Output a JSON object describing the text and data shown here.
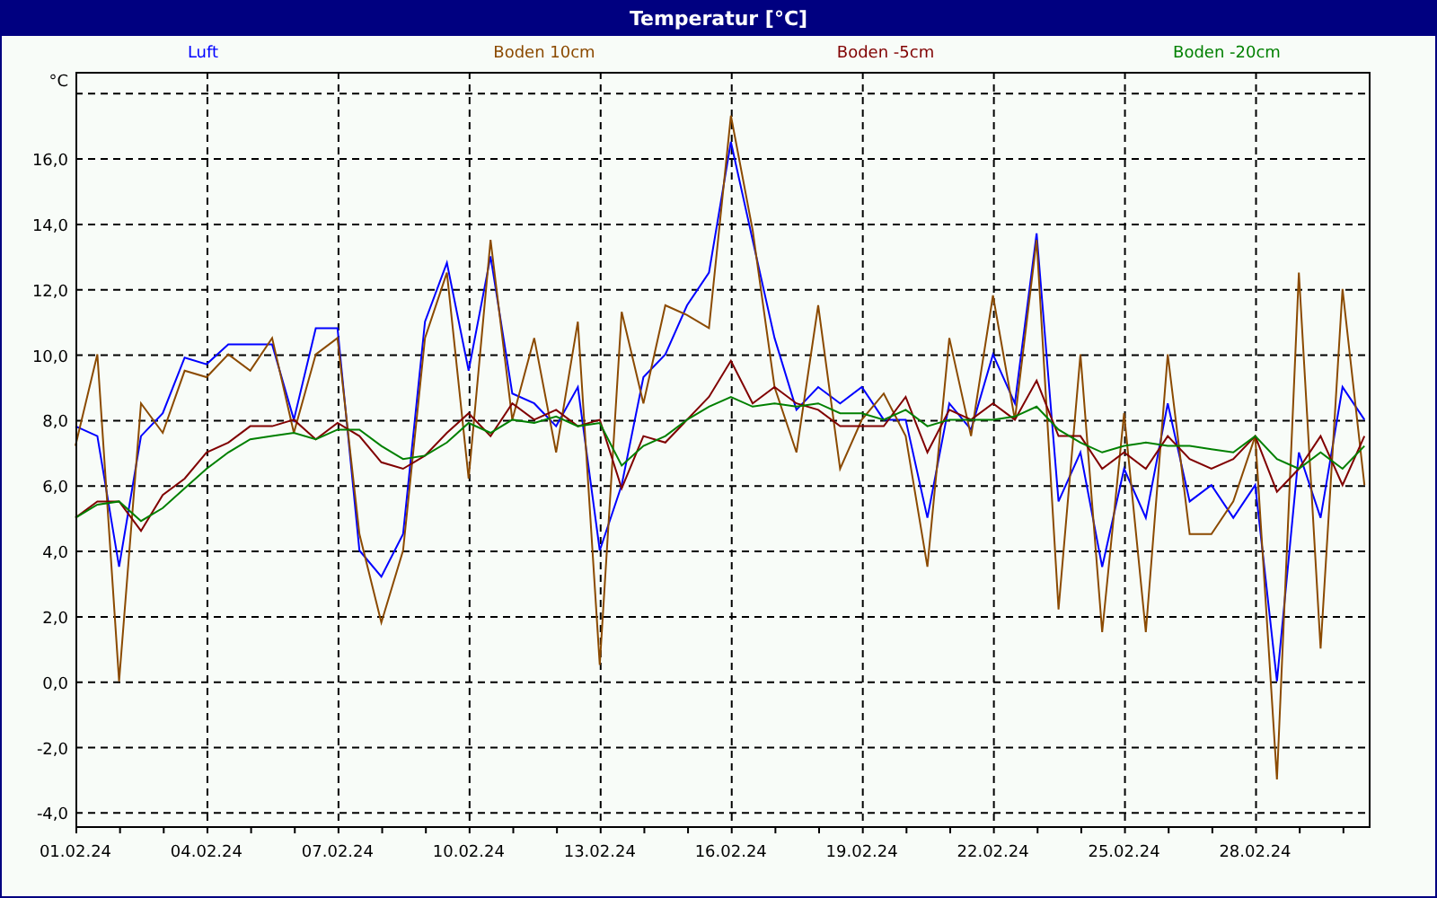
{
  "window": {
    "title": "Temperatur [°C]"
  },
  "chart": {
    "chart_data": {
      "type": "line",
      "ylabel": "°C",
      "categories": [
        "01.02.24",
        null,
        null,
        null,
        null,
        null,
        "04.02.24",
        null,
        null,
        null,
        null,
        null,
        "07.02.24",
        null,
        null,
        null,
        null,
        null,
        "10.02.24",
        null,
        null,
        null,
        null,
        null,
        "13.02.24",
        null,
        null,
        null,
        null,
        null,
        "16.02.24",
        null,
        null,
        null,
        null,
        null,
        "19.02.24",
        null,
        null,
        null,
        null,
        null,
        "22.02.24",
        null,
        null,
        null,
        null,
        null,
        "25.02.24",
        null,
        null,
        null,
        null,
        null,
        "28.02.24",
        null,
        null,
        null,
        null,
        null
      ],
      "series": [
        {
          "name": "Luft",
          "color": "#0000ff",
          "values": [
            7.8,
            7.5,
            3.5,
            7.5,
            8.2,
            9.9,
            9.7,
            10.3,
            10.3,
            10.3,
            8.0,
            10.8,
            10.8,
            4.0,
            3.2,
            4.5,
            11.0,
            12.8,
            9.5,
            13.0,
            8.8,
            8.5,
            7.8,
            9.0,
            4.0,
            6.0,
            9.3,
            10.0,
            11.5,
            12.5,
            16.5,
            13.5,
            10.5,
            8.3,
            9.0,
            8.5,
            9.0,
            8.0,
            8.0,
            5.0,
            8.5,
            7.7,
            10.0,
            8.5,
            13.7,
            5.5,
            7.0,
            3.5,
            6.5,
            5.0,
            8.5,
            5.5,
            6.0,
            5.0,
            6.0,
            0.0,
            7.0,
            5.0,
            9.0,
            8.0
          ]
        },
        {
          "name": "Boden 10cm",
          "color": "#8b4a00",
          "values": [
            7.2,
            10.0,
            0.0,
            8.5,
            7.6,
            9.5,
            9.3,
            10.0,
            9.5,
            10.5,
            7.6,
            10.0,
            10.5,
            4.5,
            1.8,
            4.0,
            10.5,
            12.5,
            6.2,
            13.5,
            8.0,
            10.5,
            7.0,
            11.0,
            0.5,
            11.3,
            8.5,
            11.5,
            11.2,
            10.8,
            17.3,
            13.8,
            9.0,
            7.0,
            11.5,
            6.5,
            8.0,
            8.8,
            7.5,
            3.5,
            10.5,
            7.5,
            11.8,
            8.0,
            13.5,
            2.2,
            10.0,
            1.5,
            8.2,
            1.5,
            10.0,
            4.5,
            4.5,
            5.5,
            7.5,
            -3.0,
            12.5,
            1.0,
            12.0,
            6.0
          ]
        },
        {
          "name": "Boden -5cm",
          "color": "#800000",
          "values": [
            5.0,
            5.5,
            5.5,
            4.6,
            5.7,
            6.2,
            7.0,
            7.3,
            7.8,
            7.8,
            8.0,
            7.4,
            7.9,
            7.5,
            6.7,
            6.5,
            6.9,
            7.6,
            8.2,
            7.5,
            8.5,
            8.0,
            8.3,
            7.8,
            8.0,
            5.9,
            7.5,
            7.3,
            8.0,
            8.7,
            9.8,
            8.5,
            9.0,
            8.5,
            8.3,
            7.8,
            7.8,
            7.8,
            8.7,
            7.0,
            8.3,
            8.0,
            8.5,
            8.0,
            9.2,
            7.5,
            7.5,
            6.5,
            7.0,
            6.5,
            7.5,
            6.8,
            6.5,
            6.8,
            7.5,
            5.8,
            6.5,
            7.5,
            6.0,
            7.5
          ]
        },
        {
          "name": "Boden -20cm",
          "color": "#008000",
          "values": [
            5.0,
            5.4,
            5.5,
            4.9,
            5.3,
            5.9,
            6.5,
            7.0,
            7.4,
            7.5,
            7.6,
            7.4,
            7.7,
            7.7,
            7.2,
            6.8,
            6.9,
            7.3,
            7.9,
            7.6,
            8.0,
            7.9,
            8.1,
            7.8,
            7.9,
            6.6,
            7.2,
            7.5,
            8.0,
            8.4,
            8.7,
            8.4,
            8.5,
            8.4,
            8.5,
            8.2,
            8.2,
            8.0,
            8.3,
            7.8,
            8.0,
            8.0,
            8.0,
            8.1,
            8.4,
            7.7,
            7.3,
            7.0,
            7.2,
            7.3,
            7.2,
            7.2,
            7.1,
            7.0,
            7.5,
            6.8,
            6.5,
            7.0,
            6.5,
            7.2
          ]
        }
      ],
      "ylim": [
        -4.43,
        18.64
      ],
      "grid": true,
      "yticks": [
        {
          "value": -4,
          "label": "-4,0"
        },
        {
          "value": -2,
          "label": "-2,0"
        },
        {
          "value": 0,
          "label": "0,0"
        },
        {
          "value": 2,
          "label": "2,0"
        },
        {
          "value": 4,
          "label": "4,0"
        },
        {
          "value": 6,
          "label": "6,0"
        },
        {
          "value": 8,
          "label": "8,0"
        },
        {
          "value": 10,
          "label": "10,0"
        },
        {
          "value": 12,
          "label": "12,0"
        },
        {
          "value": 14,
          "label": "14,0"
        },
        {
          "value": 16,
          "label": "16,0"
        }
      ]
    }
  }
}
